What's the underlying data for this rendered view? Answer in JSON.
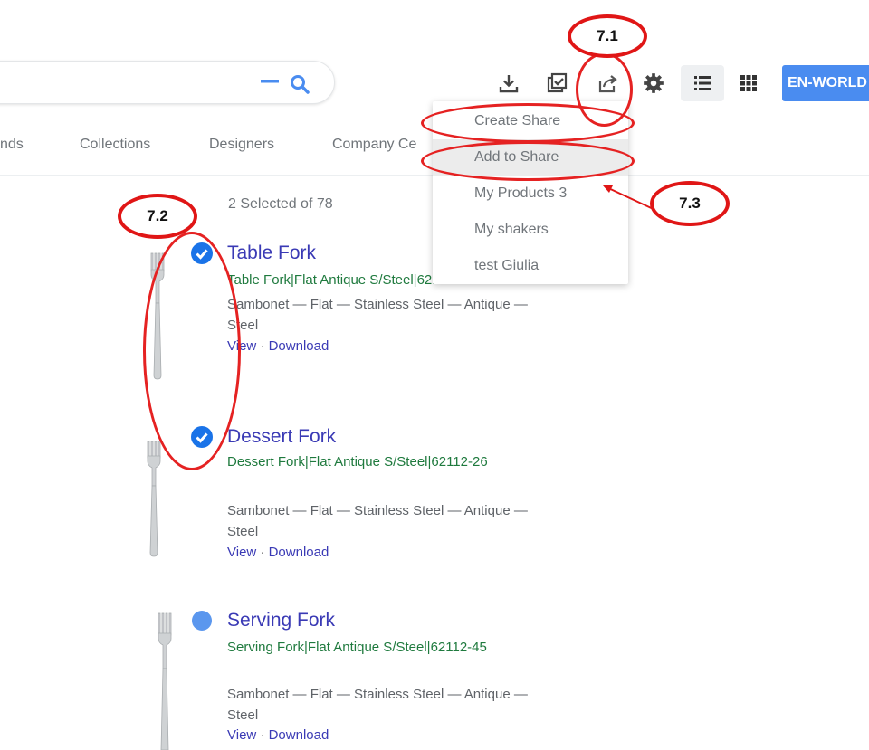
{
  "search": {
    "clear_glyph": "—",
    "search_icon": "search-icon"
  },
  "toolbar": {
    "icons": [
      "download-icon",
      "select-all-icon",
      "share-icon",
      "settings-icon",
      "list-view-icon",
      "grid-view-icon"
    ],
    "language": "EN-WORLD"
  },
  "tabs": [
    "nds",
    "Collections",
    "Designers",
    "Company Ce"
  ],
  "selection_count": "2 Selected of 78",
  "share_menu": {
    "items": [
      "Create Share",
      "Add to Share",
      "My Products 3",
      "My shakers",
      "test Giulia"
    ],
    "highlighted": "Add to Share"
  },
  "results": [
    {
      "title": "Table Fork",
      "url": "Table Fork|Flat Antique S/Steel|62112-00",
      "meta": "Sambonet — Flat — Stainless Steel — Antique — Steel",
      "view": "View",
      "sep": "·",
      "download": "Download",
      "selected": true
    },
    {
      "title": "Dessert Fork",
      "url": "Dessert Fork|Flat Antique S/Steel|62112-26",
      "meta": "Sambonet — Flat — Stainless Steel — Antique — Steel",
      "view": "View",
      "sep": "·",
      "download": "Download",
      "selected": true
    },
    {
      "title": "Serving Fork",
      "url": "Serving Fork|Flat Antique S/Steel|62112-45",
      "meta": "Sambonet — Flat — Stainless Steel — Antique — Steel",
      "view": "View",
      "sep": "·",
      "download": "Download",
      "selected": false
    }
  ],
  "annotations": {
    "a1": "7.1",
    "a2": "7.2",
    "a3": "7.3"
  },
  "colors": {
    "accent": "#4a8cf0",
    "check": "#1a73e8",
    "title_link": "#3a3ab5",
    "url_green": "#1f7a3e",
    "annotation_red": "#e01616"
  }
}
